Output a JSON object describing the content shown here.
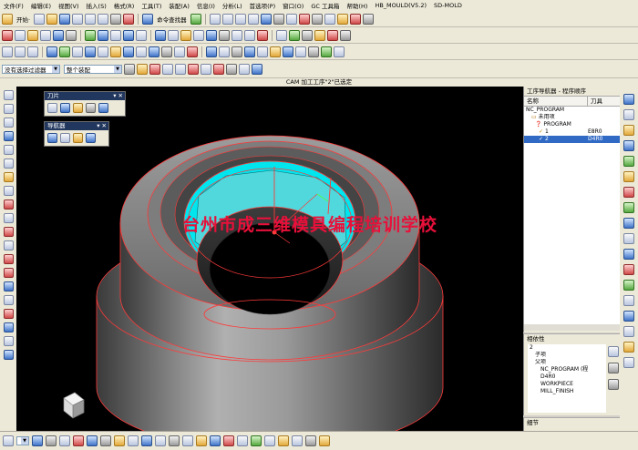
{
  "menu": [
    "文件(F)",
    "编辑(E)",
    "视图(V)",
    "插入(S)",
    "格式(R)",
    "工具(T)",
    "装配(A)",
    "信息(I)",
    "分析(L)",
    "首选项(P)",
    "窗口(O)",
    "GC 工具箱",
    "帮助(H)",
    "HB_MOULD(V5.2)",
    "SD-MOLD"
  ],
  "toolbar1": {
    "start_label": "开始·",
    "command_finder": "命令查找器"
  },
  "toolbar3": {
    "filter_value": "没有选择过滤器",
    "scope_value": "整个装配"
  },
  "window_title": "CAM 加工工序\"2\"已选定",
  "watermark": "台州市成三维模具编程培训学校",
  "float_toolbars": {
    "tool_title": "刀片",
    "navigator_title": "导航器"
  },
  "operation_navigator": {
    "title": "工序导航器 - 程序顺序",
    "col_name": "名称",
    "col_tool": "刀具",
    "rows": [
      {
        "name": "NC_PROGRAM",
        "tool": ""
      },
      {
        "name": "未用项",
        "tool": ""
      },
      {
        "name": "PROGRAM",
        "tool": ""
      },
      {
        "name": "1",
        "tool": "E8R0"
      },
      {
        "name": "2",
        "tool": "D4R0"
      }
    ]
  },
  "dependency": {
    "title": "相依性",
    "rows": [
      "2",
      "子项",
      "父项",
      "NC_PROGRAM (程",
      "D4R0",
      "WORKPIECE",
      "MILL_FINISH"
    ]
  },
  "details_title": "细节",
  "colors": {
    "model_cyan": "#00e5ee",
    "model_gray": "#8a8a8a",
    "edge_red": "#ff3a3a",
    "selection_blue": "#316ac5"
  }
}
